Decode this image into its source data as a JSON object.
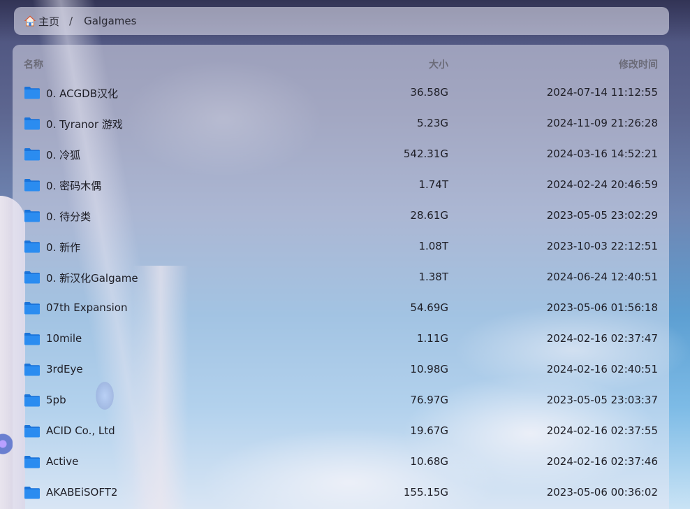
{
  "breadcrumb": {
    "home_label": "主页",
    "separator": "/",
    "current": "Galgames"
  },
  "table": {
    "columns": {
      "name": "名称",
      "size": "大小",
      "modified": "修改时间"
    },
    "rows": [
      {
        "name": "0. ACGDB汉化",
        "size": "36.58G",
        "modified": "2024-07-14 11:12:55"
      },
      {
        "name": "0. Tyranor 游戏",
        "size": "5.23G",
        "modified": "2024-11-09 21:26:28"
      },
      {
        "name": "0. 冷狐",
        "size": "542.31G",
        "modified": "2024-03-16 14:52:21"
      },
      {
        "name": "0. 密码木偶",
        "size": "1.74T",
        "modified": "2024-02-24 20:46:59"
      },
      {
        "name": "0. 待分类",
        "size": "28.61G",
        "modified": "2023-05-05 23:02:29"
      },
      {
        "name": "0. 新作",
        "size": "1.08T",
        "modified": "2023-10-03 22:12:51"
      },
      {
        "name": "0. 新汉化Galgame",
        "size": "1.38T",
        "modified": "2024-06-24 12:40:51"
      },
      {
        "name": "07th Expansion",
        "size": "54.69G",
        "modified": "2023-05-06 01:56:18"
      },
      {
        "name": "10mile",
        "size": "1.11G",
        "modified": "2024-02-16 02:37:47"
      },
      {
        "name": "3rdEye",
        "size": "10.98G",
        "modified": "2024-02-16 02:40:51"
      },
      {
        "name": "5pb",
        "size": "76.97G",
        "modified": "2023-05-05 23:03:37"
      },
      {
        "name": "ACID Co., Ltd",
        "size": "19.67G",
        "modified": "2024-02-16 02:37:55"
      },
      {
        "name": "Active",
        "size": "10.68G",
        "modified": "2024-02-16 02:37:46"
      },
      {
        "name": "AKABEiSOFT2",
        "size": "155.15G",
        "modified": "2023-05-06 00:36:02"
      }
    ]
  },
  "icons": {
    "home": "home-icon",
    "folder": "folder-icon"
  },
  "colors": {
    "folder": "#2b8cf0"
  }
}
